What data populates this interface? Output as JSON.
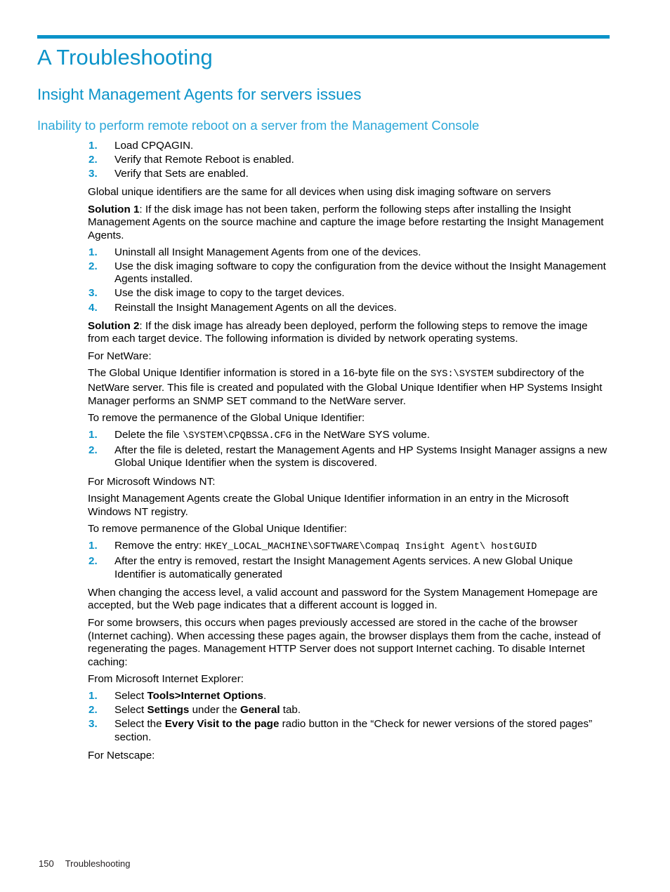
{
  "accent_color": "#0b93c9",
  "chapter": {
    "title": "A Troubleshooting"
  },
  "section": {
    "title": "Insight Management Agents for servers issues"
  },
  "subsection": {
    "title": "Inability to perform remote reboot on a server from the Management Console"
  },
  "list_reboot": {
    "items": [
      {
        "num": "1.",
        "text": "Load CPQAGIN."
      },
      {
        "num": "2.",
        "text": "Verify that Remote Reboot is enabled."
      },
      {
        "num": "3.",
        "text": "Verify that Sets are enabled."
      }
    ]
  },
  "para_guid_intro": "Global unique identifiers are the same for all devices when using disk imaging software on servers",
  "solution1": {
    "label": "Solution 1",
    "text": ": If the disk image has not been taken, perform the following steps after installing the Insight Management Agents on the source machine and capture the image before restarting the Insight Management Agents."
  },
  "list_solution1": {
    "items": [
      {
        "num": "1.",
        "text": "Uninstall all Insight Management Agents from one of the devices."
      },
      {
        "num": "2.",
        "text": "Use the disk imaging software to copy the configuration from the device without the Insight Management Agents installed."
      },
      {
        "num": "3.",
        "text": "Use the disk image to copy to the target devices."
      },
      {
        "num": "4.",
        "text": "Reinstall the Insight Management Agents on all the devices."
      }
    ]
  },
  "solution2": {
    "label": "Solution 2",
    "text": ": If the disk image has already been deployed, perform the following steps to remove the image from each target device. The following information is divided by network operating systems."
  },
  "netware": {
    "heading": "For NetWare:",
    "para_lead": "The Global Unique Identifier information is stored in a 16-byte file on the ",
    "para_mono": "SYS:\\SYSTEM",
    "para_tail": " subdirectory of the NetWare server. This file is created and populated with the Global Unique Identifier when HP Systems Insight Manager performs an SNMP SET command to the NetWare server.",
    "remove_heading": "To remove the permanence of the Global Unique Identifier:",
    "items": [
      {
        "num": "1.",
        "lead": "Delete the file ",
        "mono": "\\SYSTEM\\CPQBSSA.CFG",
        "tail": " in the NetWare SYS volume."
      },
      {
        "num": "2.",
        "lead": "After the file is deleted, restart the Management Agents and HP Systems Insight Manager assigns a new Global Unique Identifier when the system is discovered.",
        "mono": "",
        "tail": ""
      }
    ]
  },
  "windowsnt": {
    "heading": "For Microsoft Windows NT:",
    "para": "Insight Management Agents create the Global Unique Identifier information in an entry in the Microsoft Windows NT registry.",
    "remove_heading": "To remove permanence of the Global Unique Identifier:",
    "items": [
      {
        "num": "1.",
        "lead": "Remove the entry: ",
        "mono": "HKEY_LOCAL_MACHINE\\SOFTWARE\\Compaq Insight Agent\\ hostGUID",
        "tail": ""
      },
      {
        "num": "2.",
        "lead": "After the entry is removed, restart the Insight Management Agents services. A new Global Unique Identifier is automatically generated",
        "mono": "",
        "tail": ""
      }
    ]
  },
  "caching": {
    "para_access": "When changing the access level, a valid account and password for the System Management Homepage are accepted, but the Web page indicates that a different account is logged in.",
    "para_cache": "For some browsers, this occurs when pages previously accessed are stored in the cache of the browser (Internet caching). When accessing these pages again, the browser displays them from the cache, instead of regenerating the pages. Management HTTP Server does not support Internet caching. To disable Internet caching:",
    "ie_heading": "From Microsoft Internet Explorer:",
    "items": [
      {
        "num": "1.",
        "parts": [
          {
            "t": "Select ",
            "bold": false
          },
          {
            "t": "Tools>Internet Options",
            "bold": true
          },
          {
            "t": ".",
            "bold": false
          }
        ]
      },
      {
        "num": "2.",
        "parts": [
          {
            "t": "Select ",
            "bold": false
          },
          {
            "t": "Settings",
            "bold": true
          },
          {
            "t": " under the ",
            "bold": false
          },
          {
            "t": "General",
            "bold": true
          },
          {
            "t": " tab.",
            "bold": false
          }
        ]
      },
      {
        "num": "3.",
        "parts": [
          {
            "t": "Select the ",
            "bold": false
          },
          {
            "t": "Every Visit to the page",
            "bold": true
          },
          {
            "t": " radio button in the “Check for newer versions of the stored pages” section.",
            "bold": false
          }
        ]
      }
    ],
    "netscape_heading": "For Netscape:"
  },
  "footer": {
    "page_number": "150",
    "chapter_name": "Troubleshooting"
  }
}
